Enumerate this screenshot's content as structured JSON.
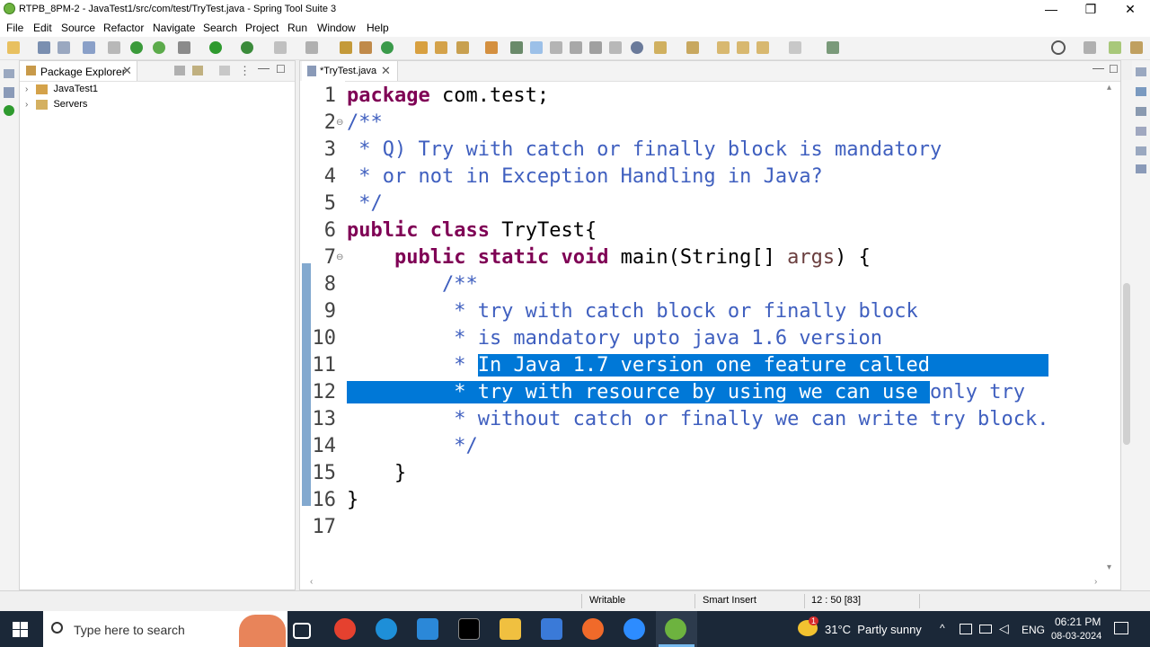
{
  "window": {
    "title": "RTPB_8PM-2 - JavaTest1/src/com/test/TryTest.java - Spring Tool Suite 3",
    "minimize_glyph": "—",
    "restore_glyph": "❐",
    "close_glyph": "✕"
  },
  "menu": [
    "File",
    "Edit",
    "Source",
    "Refactor",
    "Navigate",
    "Search",
    "Project",
    "Run",
    "Window",
    "Help"
  ],
  "package_explorer": {
    "tab_label": "Package Explorer",
    "items": [
      "JavaTest1",
      "Servers"
    ]
  },
  "editor": {
    "tab_label": "*TryTest.java",
    "lines": [
      {
        "n": "1",
        "fold": "",
        "parts": [
          {
            "t": "package",
            "c": "kw"
          },
          {
            "t": " com.test;",
            "c": ""
          }
        ]
      },
      {
        "n": "2",
        "fold": "⊖",
        "parts": [
          {
            "t": "/**",
            "c": "cm"
          }
        ]
      },
      {
        "n": "3",
        "fold": "",
        "parts": [
          {
            "t": " * Q) Try with catch or finally block is mandatory",
            "c": "cm"
          }
        ]
      },
      {
        "n": "4",
        "fold": "",
        "parts": [
          {
            "t": " * or not in Exception Handling in Java?",
            "c": "cm"
          }
        ]
      },
      {
        "n": "5",
        "fold": "",
        "parts": [
          {
            "t": " */",
            "c": "cm"
          }
        ]
      },
      {
        "n": "6",
        "fold": "",
        "parts": [
          {
            "t": "public",
            "c": "kw"
          },
          {
            "t": " ",
            "c": ""
          },
          {
            "t": "class",
            "c": "kw"
          },
          {
            "t": " TryTest{",
            "c": ""
          }
        ]
      },
      {
        "n": "7",
        "fold": "⊖",
        "parts": [
          {
            "t": "    ",
            "c": ""
          },
          {
            "t": "public",
            "c": "kw"
          },
          {
            "t": " ",
            "c": ""
          },
          {
            "t": "static",
            "c": "kw"
          },
          {
            "t": " ",
            "c": ""
          },
          {
            "t": "void",
            "c": "kw"
          },
          {
            "t": " main(String[] ",
            "c": ""
          },
          {
            "t": "args",
            "c": "pm"
          },
          {
            "t": ") {",
            "c": ""
          }
        ]
      },
      {
        "n": "8",
        "fold": "",
        "parts": [
          {
            "t": "        /**",
            "c": "cm"
          }
        ]
      },
      {
        "n": "9",
        "fold": "",
        "parts": [
          {
            "t": "         * try with catch block or finally block",
            "c": "cm"
          }
        ]
      },
      {
        "n": "10",
        "fold": "",
        "parts": [
          {
            "t": "         * is mandatory upto java 1.6 version",
            "c": "cm"
          }
        ]
      },
      {
        "n": "11",
        "fold": "",
        "parts": [
          {
            "t": "         * ",
            "c": "cm"
          },
          {
            "t": "In Java 1.7 version one feature called          ",
            "c": "sel"
          }
        ]
      },
      {
        "n": "12",
        "fold": "",
        "parts": [
          {
            "t": "         * try with resource by using we can use ",
            "c": "sel"
          },
          {
            "t": "only try",
            "c": "cm"
          }
        ]
      },
      {
        "n": "13",
        "fold": "",
        "parts": [
          {
            "t": "         * without catch or finally we can write try block.",
            "c": "cm"
          }
        ]
      },
      {
        "n": "14",
        "fold": "",
        "parts": [
          {
            "t": "         */",
            "c": "cm"
          }
        ]
      },
      {
        "n": "15",
        "fold": "",
        "parts": [
          {
            "t": "    }",
            "c": ""
          }
        ]
      },
      {
        "n": "16",
        "fold": "",
        "parts": [
          {
            "t": "}",
            "c": ""
          }
        ]
      },
      {
        "n": "17",
        "fold": "",
        "parts": []
      }
    ]
  },
  "status": {
    "writable": "Writable",
    "insert_mode": "Smart Insert",
    "position": "12 : 50 [83]"
  },
  "taskbar": {
    "search_placeholder": "Type here to search",
    "weather": "31°C  Partly sunny",
    "weather_badge": "1",
    "lang": "ENG",
    "time": "06:21 PM",
    "date": "08-03-2024"
  },
  "colors": {
    "keyword": "#7f0055",
    "comment": "#3f5fbf",
    "selection": "#0078d7",
    "taskbar": "#1b2838"
  }
}
